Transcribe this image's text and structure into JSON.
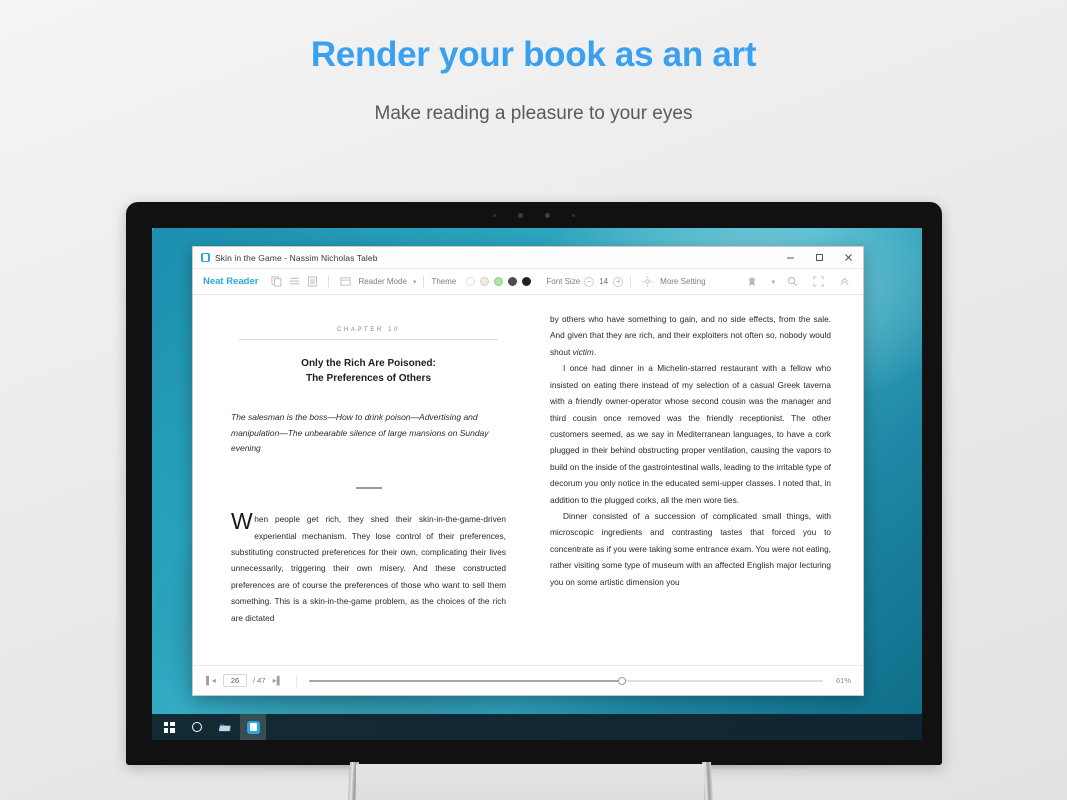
{
  "promo": {
    "headline": "Render your book as an art",
    "subheadline": "Make reading a pleasure to your eyes",
    "accent_color": "#3aa0f0"
  },
  "window": {
    "title": "Skin in the Game - Nassim Nicholas Taleb",
    "controls": {
      "minimize": "minimize-icon",
      "maximize": "maximize-icon",
      "close": "close-icon"
    }
  },
  "toolbar": {
    "brand": "Neat Reader",
    "icons": [
      "copy-icon",
      "list-icon",
      "note-icon"
    ],
    "reader_mode_label": "Reader Mode",
    "theme_label": "Theme",
    "theme_colors": [
      "#ffffff",
      "#f2ece0",
      "#aee5a3",
      "#4d4d4d",
      "#232323"
    ],
    "theme_selected_index": 0,
    "font_size_label": "Font Size",
    "font_size_value": "14",
    "font_decrease": "−",
    "font_increase": "+",
    "more_setting_label": "More Setting",
    "right_icons": [
      "bookmark-icon",
      "chevron-down-icon",
      "search-icon",
      "fullscreen-icon",
      "collapse-icon"
    ]
  },
  "book": {
    "left_page": {
      "chapter_label": "CHAPTER 10",
      "title_line1": "Only the Rich Are Poisoned:",
      "title_line2": "The Preferences of Others",
      "subtitle": "The salesman is the boss—How to drink poison—Advertising and manipulation—The unbearable silence of large mansions on Sunday evening",
      "paragraph": "When people get rich, they shed their skin-in-the-game-driven experiential mechanism. They lose control of their preferences, substituting constructed preferences for their own, complicating their lives unnecessarily, triggering their own misery. And these constructed preferences are of course the preferences of those who want to sell them something. This is a skin-in-the-game problem, as the choices of the rich are dictated"
    },
    "right_page": {
      "para1_a": "by others who have something to gain, and no side effects, from the sale. And given that they are rich, and their exploiters not often so, nobody would shout ",
      "para1_italic": "victim",
      "para1_b": ".",
      "para2": "I once had dinner in a Michelin-starred restaurant with a fellow who insisted on eating there instead of my selection of a casual Greek taverna with a friendly owner-operator whose second cousin was the manager and third cousin once removed was the friendly receptionist. The other customers seemed, as we say in Mediterranean languages, to have a cork plugged in their behind obstructing proper ventilation, causing the vapors to build on the inside of the gastrointestinal walls, leading to the irritable type of decorum you only notice in the educated semi-upper classes. I noted that, in addition to the plugged corks, all the men wore ties.",
      "para3": "Dinner consisted of a succession of complicated small things, with microscopic ingredients and contrasting tastes that forced you to concentrate as if you were taking some entrance exam. You were not eating, rather visiting some type of museum with an affected English major lecturing you on some artistic dimension you"
    }
  },
  "statusbar": {
    "first_page_icon": "first-page-icon",
    "last_page_icon": "last-page-icon",
    "current_page": "26",
    "total_pages": "/ 47",
    "progress_percent": "61%",
    "progress_value": 61
  },
  "taskbar": {
    "items": [
      "start-button",
      "cortana-search",
      "file-explorer",
      "neat-reader-app"
    ],
    "active_index": 3
  }
}
